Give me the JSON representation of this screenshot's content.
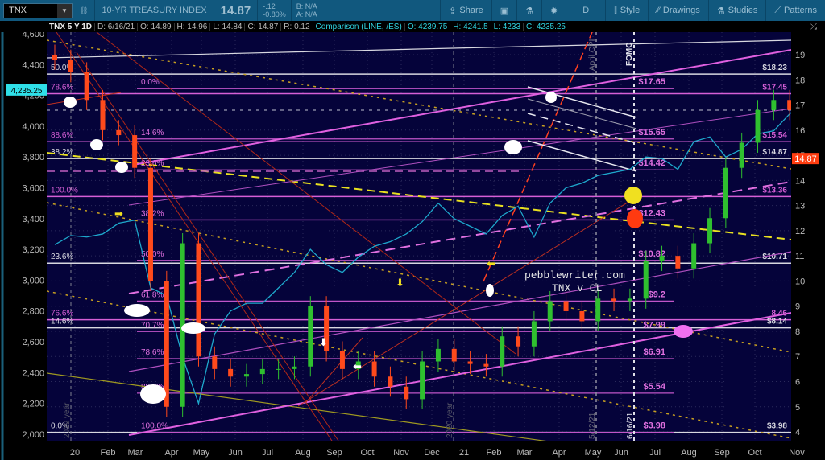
{
  "toolbar": {
    "symbol": "TNX",
    "description": "10-YR TREASURY INDEX",
    "last": "14.87",
    "change": "-.12",
    "change_pct": "-0.80%",
    "bid": "B: N/A",
    "ask": "A: N/A",
    "share": "Share",
    "period": "D",
    "style": "Style",
    "drawings": "Drawings",
    "studies": "Studies",
    "patterns": "Patterns"
  },
  "info": {
    "study": "TNX 5 Y 1D",
    "date": "D: 6/16/21",
    "open": "O: 14.89",
    "high": "H: 14.96",
    "low": "L: 14.84",
    "close": "C: 14.87",
    "range": "R: 0.12",
    "comparison": "Comparison (LINE, /ES)",
    "c_open": "O: 4239.75",
    "c_high": "H: 4241.5",
    "c_low": "L: 4233",
    "c_close": "C: 4235.25"
  },
  "chart_data": {
    "type": "candlestick",
    "title": "TNX 5 Y 1D",
    "right_axis": {
      "ticks": [
        "19",
        "18",
        "17",
        "16",
        "15",
        "14",
        "13",
        "12",
        "11",
        "10",
        "9",
        "8",
        "7",
        "6",
        "5",
        "4"
      ],
      "range": [
        3.5,
        19.9
      ]
    },
    "left_axis": {
      "ticks": [
        "4,600",
        "4,400",
        "4,200",
        "4,000",
        "3,800",
        "3,600",
        "3,400",
        "3,200",
        "3,000",
        "2,800",
        "2,600",
        "2,400",
        "2,200",
        "2,000"
      ],
      "range": [
        1960,
        4650
      ]
    },
    "x_ticks": [
      "20",
      "Feb",
      "Mar",
      "Apr",
      "May",
      "Jun",
      "Jul",
      "Aug",
      "Sep",
      "Oct",
      "Nov",
      "Dec",
      "21",
      "Feb",
      "Mar",
      "Apr",
      "May",
      "Jun",
      "Jul",
      "Aug",
      "Sep",
      "Oct",
      "Nov"
    ],
    "x_unit": "months since Jan 2020, semi-monthly samples",
    "tnx_close": [
      18.8,
      18.3,
      17.2,
      16.0,
      15.8,
      14.5,
      10.0,
      5.0,
      11.5,
      7.0,
      6.5,
      6.2,
      6.3,
      6.5,
      6.5,
      6.6,
      9.0,
      7.2,
      6.5,
      6.8,
      6.2,
      5.8,
      5.3,
      6.8,
      7.3,
      6.8,
      6.7,
      6.6,
      7.8,
      7.4,
      8.4,
      9.2,
      8.8,
      8.4,
      9.3,
      9.2,
      9.3,
      10.8,
      11.0,
      10.5,
      11.5,
      12.5,
      14.5,
      15.5,
      16.8,
      17.2,
      16.8,
      15.8,
      16.3,
      15.8,
      16.3,
      15.8,
      15.6,
      14.87
    ],
    "comparison_es": [
      3230,
      3290,
      3280,
      3300,
      3370,
      3390,
      2950,
      2900,
      2500,
      2200,
      2650,
      2800,
      2850,
      2850,
      2950,
      3050,
      3200,
      3100,
      3050,
      3150,
      3220,
      3250,
      3300,
      3380,
      3500,
      3400,
      3350,
      3300,
      3420,
      3480,
      3280,
      3500,
      3600,
      3630,
      3680,
      3700,
      3720,
      3800,
      3790,
      3720,
      3900,
      3930,
      3800,
      3850,
      3950,
      3970,
      4080,
      4160,
      4180,
      4190,
      4100,
      4200,
      4230,
      4235.25
    ],
    "last_tnx": "14.87",
    "last_es": "4,235.25",
    "levels_full": [
      {
        "value": 18.23,
        "pct": "50.0%",
        "price": "$18.23",
        "color": "#d8d8e0"
      },
      {
        "value": 17.45,
        "pct": "78.6%",
        "price": "$17.45",
        "color": "#d65fd6"
      },
      {
        "value": 15.54,
        "pct": "88.6%",
        "price": "$15.54",
        "color": "#d65fd6"
      },
      {
        "value": 14.87,
        "pct": "38.2%",
        "price": "$14.87",
        "color": "#d8d8e0"
      },
      {
        "value": 13.36,
        "pct": "100.0%",
        "price": "$13.36",
        "color": "#d65fd6"
      },
      {
        "value": 10.71,
        "pct": "23.6%",
        "price": "$10.71",
        "color": "#d8d8e0"
      },
      {
        "value": 8.46,
        "pct": "76.6%",
        "price": "8.46",
        "color": "#d65fd6"
      },
      {
        "value": 8.14,
        "pct": "14.6%",
        "price": "$8.14",
        "color": "#d8d8e0"
      },
      {
        "value": 3.98,
        "pct": "0.0%",
        "price": "$3.98",
        "color": "#d8d8e0"
      }
    ],
    "levels_mid": [
      {
        "value": 17.65,
        "pct": "0.0%",
        "price": "$17.65"
      },
      {
        "value": 15.65,
        "pct": "14.6%",
        "price": "$15.65"
      },
      {
        "value": 14.42,
        "pct": "23.6%",
        "price": "$14.42"
      },
      {
        "value": 12.43,
        "pct": "38.2%",
        "price": "$12.43"
      },
      {
        "value": 10.82,
        "pct": "50.0%",
        "price": "$10.82"
      },
      {
        "value": 9.2,
        "pct": "61.8%",
        "price": "$9.2"
      },
      {
        "value": 7.99,
        "pct": "70.7%",
        "price": "$7.99"
      },
      {
        "value": 6.91,
        "pct": "78.6%",
        "price": "$6.91"
      },
      {
        "value": 5.54,
        "pct": "88.6%",
        "price": "$5.54"
      },
      {
        "value": 3.98,
        "pct": "100.0%",
        "price": "$3.98"
      }
    ],
    "annotations": {
      "watermark": "pebblewriter.com",
      "subtitle": "TNX v CL",
      "fomc": "FOMC",
      "april_cpi": "April CPI",
      "year_2019": "2019 year",
      "year_2020": "2020 year",
      "date_1": "5/12/21",
      "date_2": "6/16/21"
    },
    "colors": {
      "up": "#2fc02f",
      "down": "#ff4a1c",
      "comparison": "#1ea8cc",
      "background": "#05033a",
      "last_badge": "#ff3d10",
      "comp_badge": "#2fe0e8"
    }
  }
}
